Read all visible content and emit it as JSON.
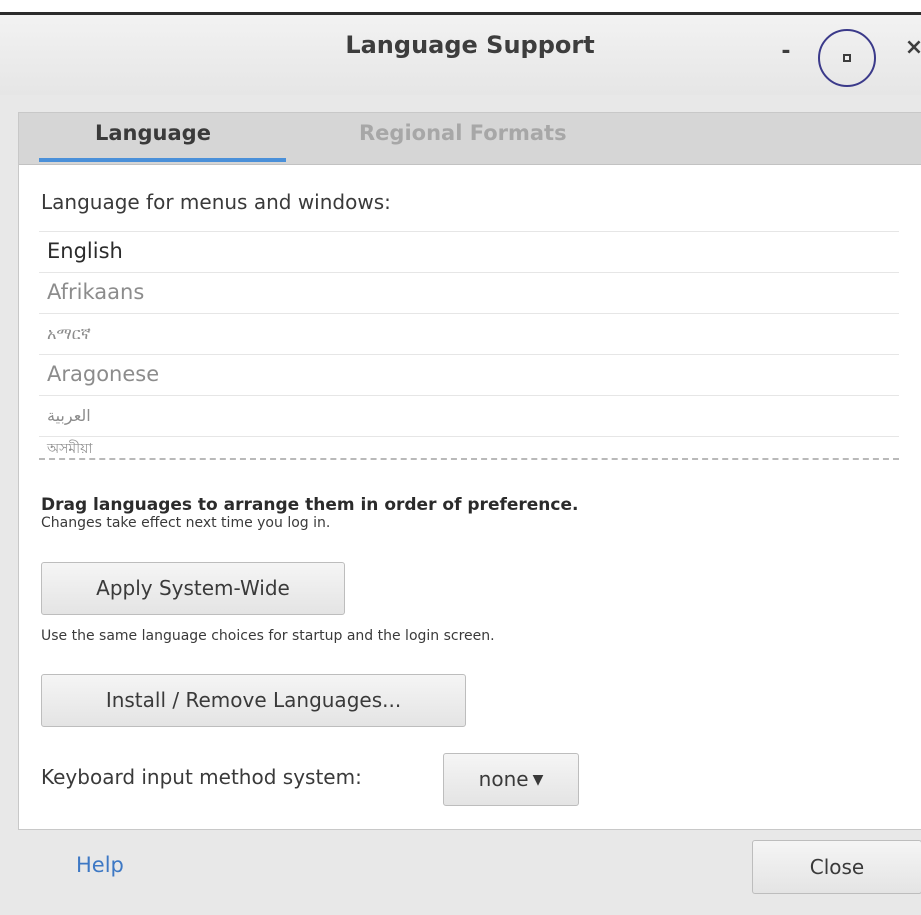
{
  "window": {
    "title": "Language Support",
    "minimize_label": "-",
    "close_label": "×"
  },
  "tabs": [
    {
      "label": "Language",
      "active": true
    },
    {
      "label": "Regional Formats",
      "active": false
    }
  ],
  "language_section": {
    "label": "Language for menus and windows:",
    "languages": [
      "English",
      "Afrikaans",
      "አማርኛ",
      "Aragonese",
      "العربية",
      "অসমীয়া"
    ],
    "selected": "English"
  },
  "drag_hint": {
    "bold": "Drag languages to arrange them in order of preference.",
    "sub": "Changes take effect next time you log in."
  },
  "apply_system_wide": {
    "label": "Apply System-Wide",
    "description": "Use the same language choices for startup and the login screen."
  },
  "install_remove": {
    "label": "Install / Remove Languages..."
  },
  "keyboard_input": {
    "label": "Keyboard input method system:",
    "selected": "none"
  },
  "footer": {
    "help_label": "Help",
    "close_label": "Close"
  },
  "colors": {
    "accent": "#4a90d9",
    "link": "#3d78c4",
    "highlight_circle": "#3b3a8a"
  }
}
